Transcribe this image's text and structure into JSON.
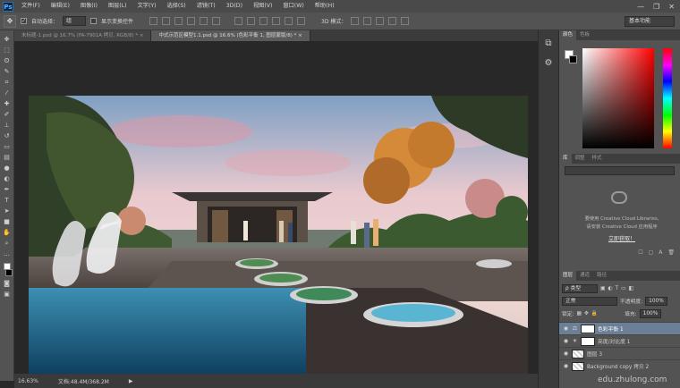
{
  "app": {
    "logo": "Ps",
    "colors": {
      "chrome_dark": "#3b3b3b",
      "panel": "#535353",
      "selection": "#6b7f96"
    }
  },
  "menu": [
    "文件(F)",
    "编辑(E)",
    "图像(I)",
    "图层(L)",
    "文字(Y)",
    "选择(S)",
    "滤镜(T)",
    "3D(D)",
    "视图(V)",
    "窗口(W)",
    "帮助(H)"
  ],
  "window_controls": [
    "—",
    "❐",
    "✕"
  ],
  "options_bar": {
    "auto_select_label": "自动选择：",
    "auto_select_value": "组",
    "show_transform_label": "显示变换控件",
    "mode_3d_label": "3D 模式：",
    "workspace": "基本功能"
  },
  "tabs": [
    {
      "label": "未标题-1.psd @ 16.7% (FA-7901A 拷贝, RGB/8) * ×"
    },
    {
      "label": "中式示范区模型1.1.psd @ 16.6% (色彩平衡 1, 图层蒙版/8) * ×"
    }
  ],
  "status": {
    "zoom": "16.63%",
    "doc": "文档:48.4M/368.2M"
  },
  "color_panel": {
    "tabs": [
      "颜色",
      "色板"
    ]
  },
  "libraries_panel": {
    "tabs": [
      "库",
      "调整",
      "样式"
    ],
    "message_line1": "要使用 Creative Cloud Libraries,",
    "message_line2": "请安装 Creative Cloud 应用程序",
    "link": "立即获取！"
  },
  "layers_panel": {
    "tabs": [
      "图层",
      "通道",
      "路径"
    ],
    "kind_label": "ρ 类型",
    "blend_mode": "正常",
    "opacity_label": "不透明度:",
    "opacity_value": "100%",
    "lock_label": "锁定:",
    "fill_label": "填充:",
    "fill_value": "100%",
    "layers": [
      {
        "name": "色彩平衡 1",
        "selected": true,
        "type": "adjustment"
      },
      {
        "name": "亮度/对比度 1",
        "selected": false,
        "type": "adjustment"
      },
      {
        "name": "图层 3",
        "selected": false,
        "type": "pixel"
      },
      {
        "name": "Background copy 拷贝 2",
        "selected": false,
        "type": "pixel"
      }
    ]
  },
  "watermark": "edu.zhulong.com"
}
